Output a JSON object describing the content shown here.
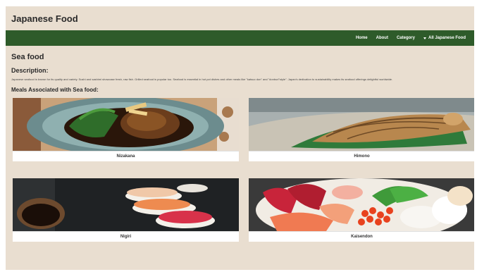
{
  "site": {
    "title": "Japanese Food"
  },
  "nav": {
    "items": [
      "Home",
      "About",
      "Category"
    ],
    "dropdown_label": "All Japanese Food"
  },
  "page": {
    "heading": "Sea food",
    "description_heading": "Description:",
    "description_text": "Japanese seafood is known for its quality and variety. Sushi and sashimi showcase fresh, raw fish. Grilled seafood is popular too. Seafood is essential in hot pot dishes and other meals like \"katsuo don\" and \"donburi\"style\". Japan's dedication to sustainability makes its seafood offerings delightful worldwide.",
    "meals_heading": "Meals Associated with Sea food:"
  },
  "meals": [
    {
      "name": "Nizakana"
    },
    {
      "name": "Himono"
    },
    {
      "name": "Nigiri"
    },
    {
      "name": "Kaisendon"
    }
  ],
  "colors": {
    "nav_bg": "#2e5b2a",
    "page_bg": "#e9ded0"
  }
}
